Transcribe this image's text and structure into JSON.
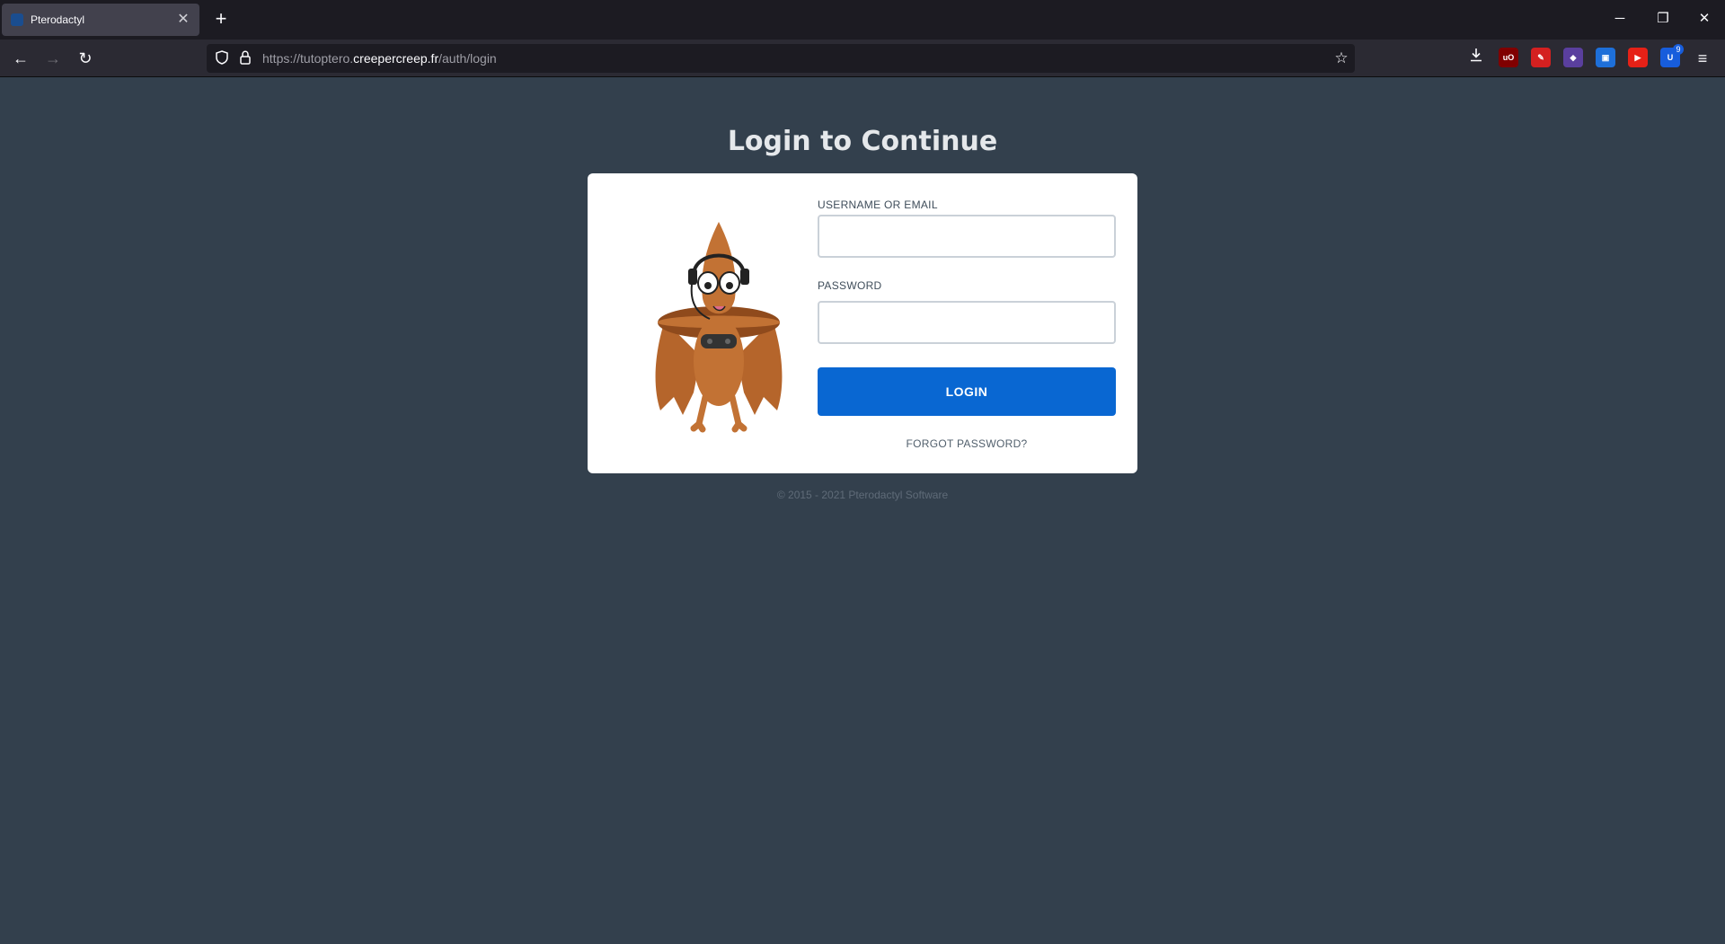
{
  "browser": {
    "tab": {
      "title": "Pterodactyl",
      "close_label": "✕"
    },
    "new_tab_label": "+",
    "window_controls": {
      "minimize": "─",
      "restore": "❐",
      "close": "✕"
    },
    "nav": {
      "back": "←",
      "forward": "→",
      "reload": "↻"
    },
    "url": {
      "prefix": "https://tutoptero.",
      "host": "creepercreep.fr",
      "path": "/auth/login"
    },
    "extensions": [
      {
        "name": "ublock-icon",
        "label": "uO",
        "color": "#800000"
      },
      {
        "name": "tool-extension-icon",
        "label": "✎",
        "color": "#d42020"
      },
      {
        "name": "purple-extension-icon",
        "label": "◆",
        "color": "#5a3f9e"
      },
      {
        "name": "translate-extension-icon",
        "label": "▣",
        "color": "#1e6fd9"
      },
      {
        "name": "youtube-extension-icon",
        "label": "▶",
        "color": "#e62117"
      },
      {
        "name": "bitwarden-extension-icon",
        "label": "U",
        "color": "#175ddc"
      }
    ],
    "bitwarden_badge": "9",
    "menu_label": "≡"
  },
  "page": {
    "title": "Login to Continue",
    "form": {
      "username_label": "USERNAME OR EMAIL",
      "username_value": "",
      "password_label": "PASSWORD",
      "password_value": "",
      "submit_label": "LOGIN",
      "forgot_label": "FORGOT PASSWORD?"
    },
    "footer": "© 2015 - 2021 Pterodactyl Software"
  },
  "colors": {
    "page_bg": "#33404d",
    "card_bg": "#ffffff",
    "primary_button": "#0967d2",
    "mascot": "#b5652b"
  }
}
